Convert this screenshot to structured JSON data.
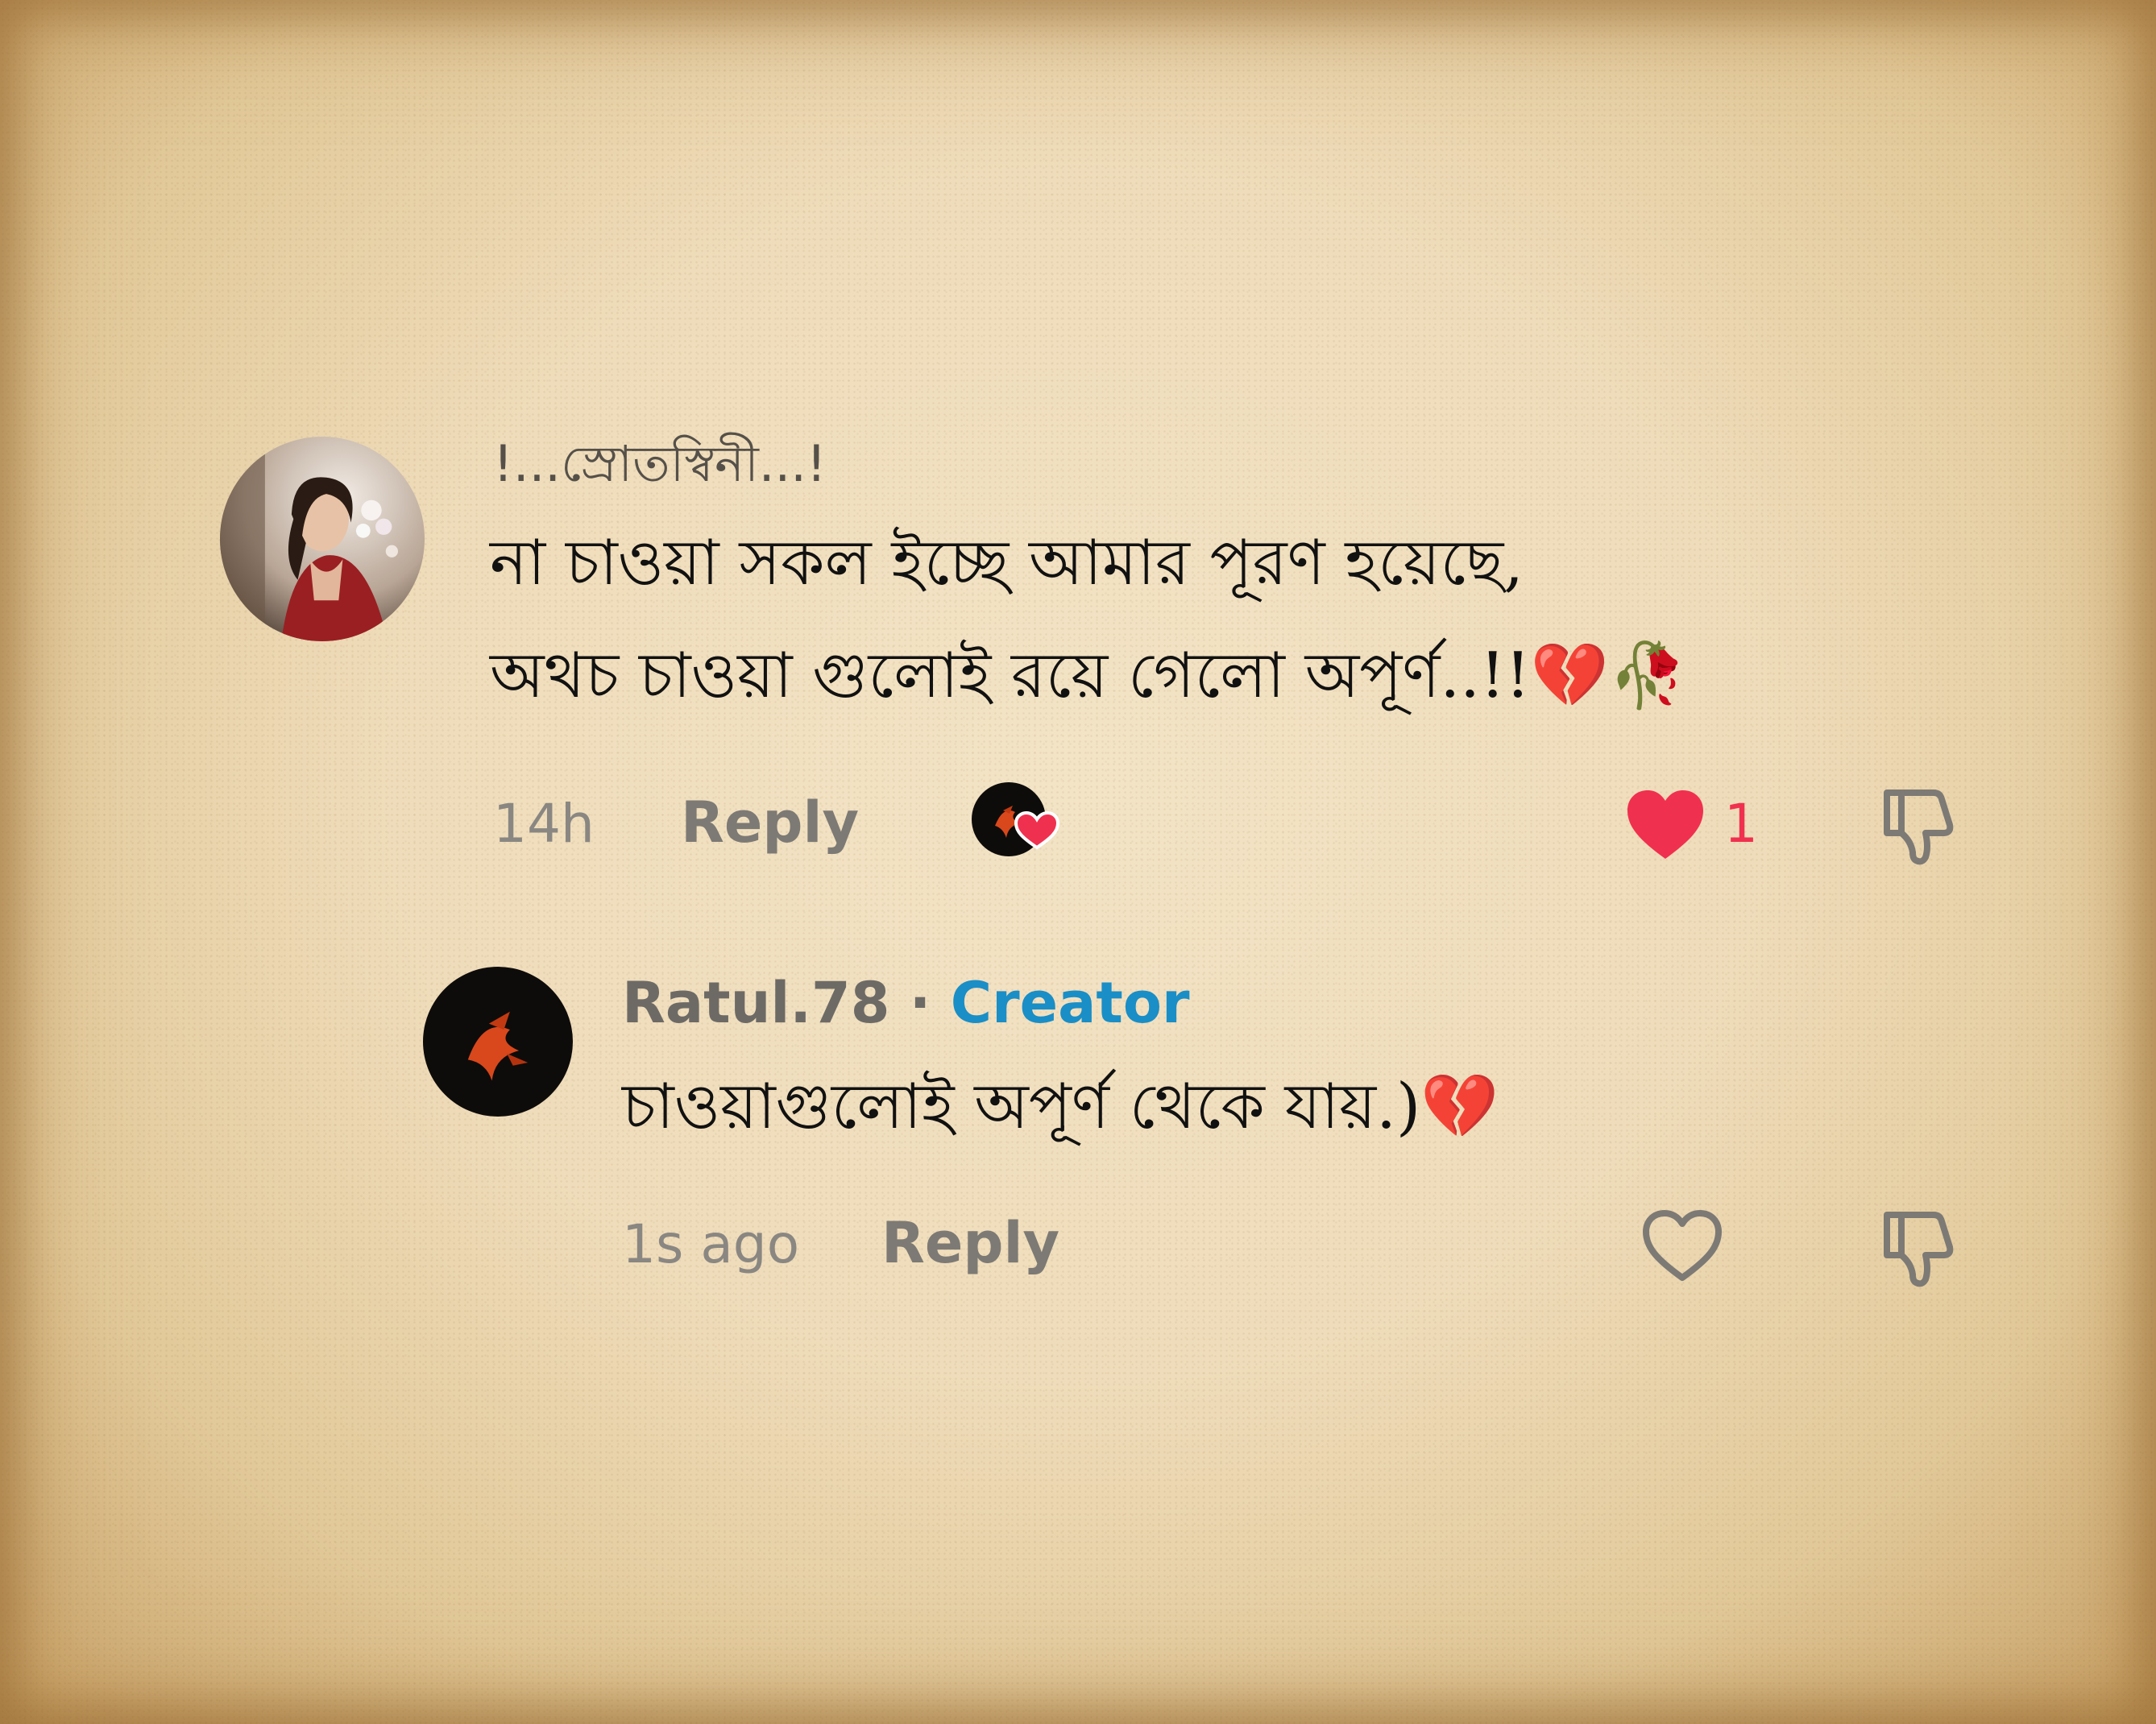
{
  "comments": [
    {
      "author": "!...স্রোতস্বিনী...!",
      "text_line1": "না চাওয়া সকল ইচ্ছে আমার পূরণ হয়েছে,",
      "text_line2": "অথচ চাওয়া গুলোই রয়ে গেলো অপূর্ণ..!!",
      "emoji": "💔🥀",
      "time": "14h",
      "reply_label": "Reply",
      "like_count": "1",
      "liked": true,
      "creator_liked": true
    }
  ],
  "reply": {
    "author": "Ratul.78",
    "separator": " · ",
    "badge": "Creator",
    "text": "চাওয়াগুলোই অপূর্ণ থেকে যায়.)",
    "emoji": "💔",
    "time": "1s ago",
    "reply_label": "Reply",
    "liked": false
  },
  "colors": {
    "like_red": "#f0304f",
    "creator_blue": "#1a8ec6"
  },
  "icons": [
    "heart-icon",
    "heart-outline-icon",
    "thumbs-down-icon",
    "creator-liked-badge"
  ]
}
